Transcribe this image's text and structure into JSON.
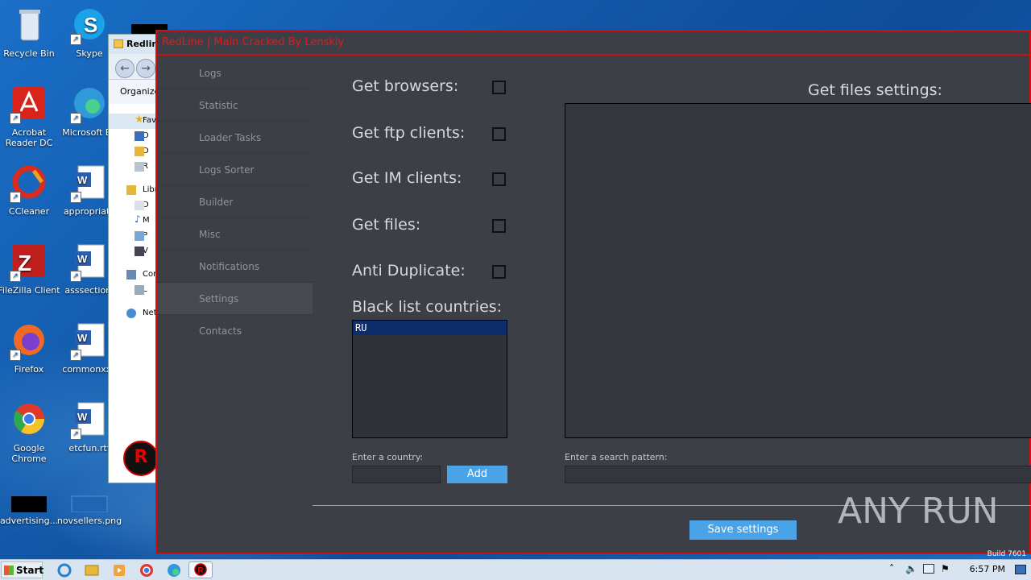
{
  "desktop": {
    "icons": [
      {
        "label": "Recycle Bin",
        "icon": "recycle-bin-icon"
      },
      {
        "label": "Skype",
        "icon": "skype-icon"
      },
      {
        "label": "Acrobat Reader DC",
        "icon": "acrobat-icon"
      },
      {
        "label": "Microsoft Ed",
        "icon": "edge-icon"
      },
      {
        "label": "CCleaner",
        "icon": "ccleaner-icon"
      },
      {
        "label": "appropriate",
        "icon": "word-doc-icon"
      },
      {
        "label": "FileZilla Client",
        "icon": "filezilla-icon"
      },
      {
        "label": "asssection.",
        "icon": "word-doc-icon"
      },
      {
        "label": "Firefox",
        "icon": "firefox-icon"
      },
      {
        "label": "commonxxx",
        "icon": "word-doc-icon"
      },
      {
        "label": "Google Chrome",
        "icon": "chrome-icon"
      },
      {
        "label": "etcfun.rtf",
        "icon": "word-doc-icon"
      },
      {
        "label": "advertising...",
        "icon": "black-file-icon"
      },
      {
        "label": "novsellers.png",
        "icon": "image-file-icon"
      }
    ]
  },
  "explorer": {
    "title": "Redlin",
    "organize": "Organize",
    "items": [
      "Fav",
      "D",
      "D",
      "R",
      "Libr",
      "D",
      "M",
      "P",
      "V",
      "Cor",
      "L",
      "Net"
    ]
  },
  "app": {
    "title": "RedLine | Main Cracked By Lenskiy",
    "nav": [
      {
        "label": "Logs",
        "active": false
      },
      {
        "label": "Statistic",
        "active": false
      },
      {
        "label": "Loader Tasks",
        "active": false
      },
      {
        "label": "Logs Sorter",
        "active": false
      },
      {
        "label": "Builder",
        "active": false
      },
      {
        "label": "Misc",
        "active": false
      },
      {
        "label": "Notifications",
        "active": false
      },
      {
        "label": "Settings",
        "active": true
      },
      {
        "label": "Contacts",
        "active": false
      }
    ],
    "settings": {
      "get_browsers": "Get browsers:",
      "get_ftp": "Get ftp clients:",
      "get_im": "Get IM clients:",
      "get_files": "Get files:",
      "anti_duplicate": "Anti Duplicate:",
      "blacklist_title": "Black list countries:",
      "blacklist": [
        "RU"
      ],
      "enter_country": "Enter a country:",
      "add": "Add",
      "files_title": "Get files settings:",
      "enter_pattern": "Enter a search pattern:",
      "save": "Save settings"
    },
    "watermark": "ANY RUN"
  },
  "taskbar": {
    "start": "Start",
    "clock": "6:57 PM",
    "build": "Build 7601"
  },
  "colors": {
    "accent_red": "#d01010",
    "button_blue": "#4aa3e6",
    "app_bg": "#3c3f46"
  }
}
